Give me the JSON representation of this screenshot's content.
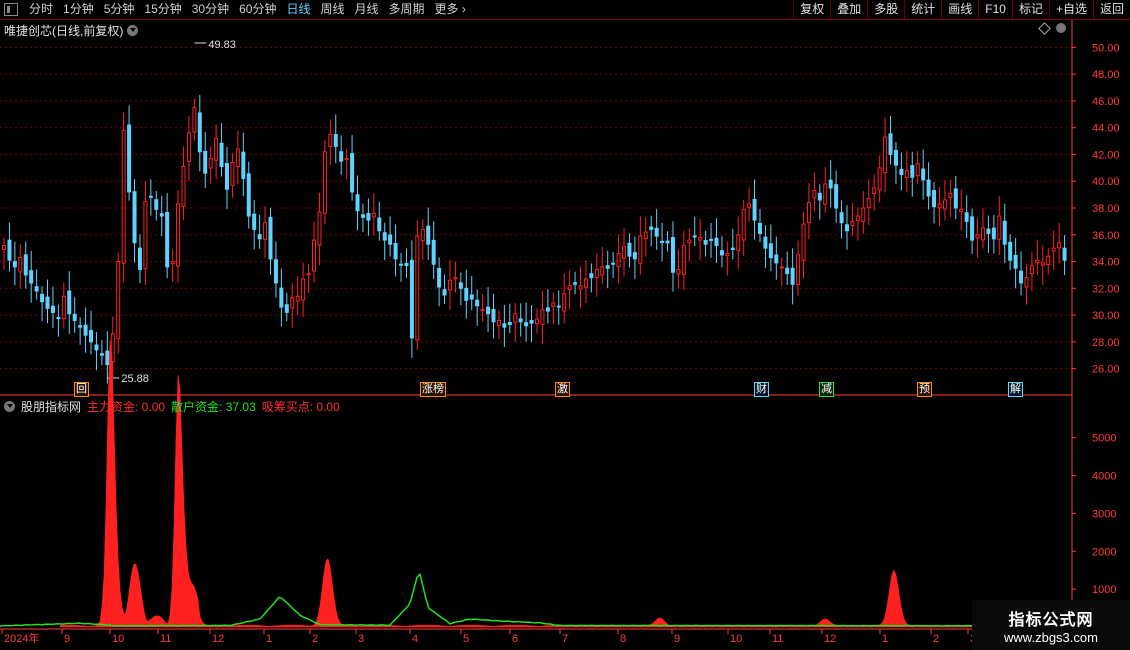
{
  "toolbar": {
    "periods": [
      "分时",
      "1分钟",
      "5分钟",
      "15分钟",
      "30分钟",
      "60分钟",
      "日线",
      "周线",
      "月线",
      "多周期",
      "更多"
    ],
    "active_period": "日线",
    "actions": [
      "复权",
      "叠加",
      "多股",
      "统计",
      "画线",
      "F10",
      "标记",
      "+自选",
      "返回"
    ]
  },
  "main": {
    "title": "唯捷创芯(日线,前复权)",
    "high_label": "49.83",
    "low_label": "25.88",
    "y_ticks": [
      "50.00",
      "48.00",
      "46.00",
      "44.00",
      "42.00",
      "40.00",
      "38.00",
      "36.00",
      "34.00",
      "32.00",
      "30.00",
      "28.00",
      "26.00"
    ],
    "events": [
      {
        "label": "回",
        "type": "plain"
      },
      {
        "label": "涨榜",
        "type": "plain"
      },
      {
        "label": "激",
        "type": "plain"
      },
      {
        "label": "财",
        "type": "blue"
      },
      {
        "label": "减",
        "type": "green"
      },
      {
        "label": "预",
        "type": "plain"
      },
      {
        "label": "解",
        "type": "blue"
      }
    ]
  },
  "indicator": {
    "name": "股朋指标网",
    "main_label": "主力资金: 0.00",
    "retail_label": "散户资金: 37.03",
    "accum_label": "吸筹买点: 0.00",
    "y_ticks": [
      "5000",
      "4000",
      "3000",
      "2000",
      "1000"
    ]
  },
  "x_axis": {
    "labels": [
      "2024年",
      "9",
      "10",
      "11",
      "12",
      "1",
      "2",
      "3",
      "4",
      "5",
      "6",
      "7",
      "8",
      "9",
      "10",
      "11",
      "12",
      "1",
      "2",
      "3"
    ]
  },
  "watermark": {
    "line1": "指标公式网",
    "line2": "www.zbgs3.com"
  },
  "colors": {
    "up": "#ff2020",
    "down": "#5fd3ff",
    "retail": "#22e022",
    "axis": "#ff3b3b",
    "grid": "#7a0000"
  },
  "chart_data": {
    "type": "candlestick",
    "y_range": [
      25,
      51
    ],
    "closes": [
      35.2,
      34.1,
      33.6,
      34.3,
      33.0,
      32.4,
      31.8,
      31.0,
      30.5,
      30.2,
      29.8,
      31.4,
      30.1,
      29.6,
      29.1,
      28.5,
      28.0,
      27.4,
      27.0,
      26.3,
      28.6,
      34.0,
      43.8,
      39.2,
      35.4,
      33.4,
      38.5,
      38.8,
      37.9,
      37.4,
      33.6,
      34.0,
      38.3,
      41.1,
      43.6,
      45.5,
      42.2,
      40.6,
      41.7,
      43.2,
      41.1,
      39.4,
      41.4,
      42.4,
      40.2,
      37.4,
      36.4,
      35.7,
      36.9,
      34.2,
      32.4,
      30.6,
      30.2,
      31.3,
      31.4,
      32.7,
      33.1,
      35.6,
      37.7,
      42.2,
      43.5,
      42.6,
      41.5,
      41.7,
      39.2,
      37.8,
      37.3,
      37.1,
      37.6,
      36.3,
      35.6,
      35.3,
      34.2,
      33.8,
      33.7,
      28.3,
      35.9,
      36.4,
      35.3,
      33.8,
      32.1,
      31.5,
      32.6,
      32.8,
      32.0,
      31.1,
      31.2,
      30.7,
      30.4,
      30.1,
      29.5,
      29.6,
      29.1,
      29.3,
      30.1,
      29.5,
      29.2,
      29.4,
      29.7,
      30.4,
      30.3,
      30.9,
      30.6,
      31.6,
      32.2,
      32.3,
      32.2,
      32.7,
      32.8,
      33.4,
      33.6,
      33.5,
      33.8,
      34.6,
      35.1,
      34.4,
      34.2,
      35.9,
      36.2,
      36.4,
      35.9,
      35.5,
      35.4,
      33.2,
      33.4,
      35.2,
      35.6,
      35.9,
      35.8,
      35.3,
      35.6,
      35.2,
      34.5,
      34.6,
      34.9,
      36.0,
      37.9,
      38.3,
      37.1,
      36.1,
      35.0,
      34.3,
      33.9,
      33.6,
      33.1,
      32.3,
      34.5,
      36.8,
      38.4,
      39.3,
      38.6,
      39.8,
      39.5,
      38.0,
      36.9,
      36.3,
      37.0,
      37.4,
      38.0,
      38.7,
      39.5,
      41.0,
      43.3,
      42.0,
      41.2,
      40.5,
      40.8,
      40.3,
      41.3,
      40.1,
      38.9,
      38.1,
      38.3,
      38.6,
      39.1,
      38.0,
      37.9,
      37.0,
      35.6,
      36.0,
      36.5,
      36.1,
      35.7,
      37.4,
      35.3,
      34.1,
      33.5,
      32.4,
      32.8,
      33.7,
      34.1,
      33.9,
      34.4,
      35.0,
      35.4,
      34.1
    ]
  }
}
